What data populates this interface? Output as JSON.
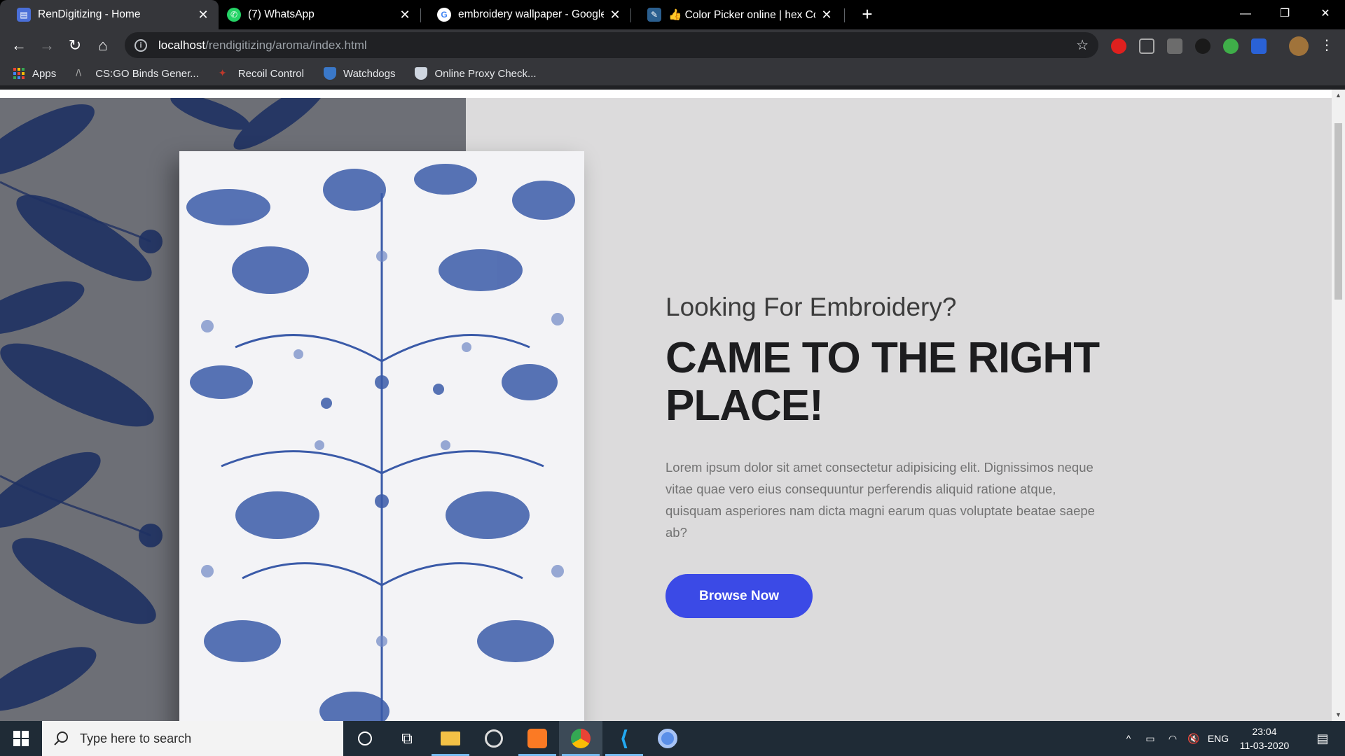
{
  "browser": {
    "tabs": [
      {
        "title": "RenDigitizing - Home",
        "favicon": "page-favicon-icon",
        "active": true
      },
      {
        "title": "(7) WhatsApp",
        "favicon": "whatsapp-icon",
        "active": false
      },
      {
        "title": "embroidery wallpaper - Google S",
        "favicon": "google-icon",
        "active": false
      },
      {
        "title": "👍 Color Picker online | hex Colo",
        "favicon": "color-picker-icon",
        "active": false
      }
    ],
    "url_host": "localhost",
    "url_path": "/rendigitizing/aroma/index.html",
    "bookmarks": [
      {
        "label": "Apps",
        "icon": "apps-grid-icon"
      },
      {
        "label": "CS:GO Binds Gener...",
        "icon": "csgo-icon"
      },
      {
        "label": "Recoil Control",
        "icon": "recoil-icon"
      },
      {
        "label": "Watchdogs",
        "icon": "shield-icon"
      },
      {
        "label": "Online Proxy Check...",
        "icon": "proxy-icon"
      }
    ]
  },
  "hero": {
    "subtitle": "Looking For Embroidery?",
    "title_line1": "CAME TO THE RIGHT",
    "title_line2": "PLACE!",
    "body": "Lorem ipsum dolor sit amet consectetur adipisicing elit. Dignissimos neque vitae quae vero eius consequuntur perferendis aliquid ratione atque, quisquam asperiores nam dicta magni earum quas voluptate beatae saepe ab?",
    "button_label": "Browse Now"
  },
  "taskbar": {
    "search_placeholder": "Type here to search",
    "language": "ENG",
    "time": "23:04",
    "date": "11-03-2020"
  },
  "colors": {
    "accent_button": "#3b4ae6",
    "page_bg": "#dcdbdc",
    "pattern_blue": "#3a5aa8"
  }
}
